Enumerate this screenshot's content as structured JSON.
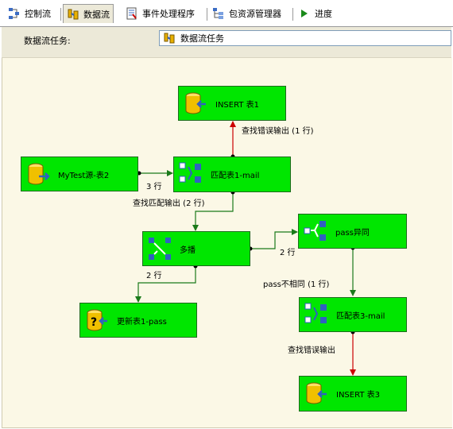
{
  "tabs": [
    {
      "label": "控制流",
      "icon": "control-flow-icon",
      "active": false
    },
    {
      "label": "数据流",
      "icon": "data-flow-icon",
      "active": true
    },
    {
      "label": "事件处理程序",
      "icon": "event-handler-icon",
      "active": false
    },
    {
      "label": "包资源管理器",
      "icon": "package-explorer-icon",
      "active": false
    },
    {
      "label": "进度",
      "icon": "progress-icon",
      "active": false
    }
  ],
  "task": {
    "label": "数据流任务:",
    "selected_value": "数据流任务"
  },
  "nodes": {
    "insert_table1": "INSERT 表1",
    "source": "MyTest源-表2",
    "match_email": "匹配表1-mail",
    "multicast": "多播",
    "pass_diff": "pass异同",
    "update_table1": "更新表1-pass",
    "match_table3": "匹配表3-mail",
    "insert_table3": "INSERT 表3"
  },
  "flow_labels": {
    "error_out1": "查找错误输出 (1 行)",
    "rows3": "3 行",
    "match_out": "查找匹配输出 (2 行)",
    "rows2a": "2 行",
    "rows2b": "2 行",
    "pass_not_same": "pass不相同 (1 行)",
    "error_out2": "查找错误输出"
  },
  "colors": {
    "node_fill": "#00e600",
    "flow_green": "#1a7a1a",
    "flow_red": "#cc0000",
    "canvas_bg": "#fbf8e6",
    "toolbar_bg": "#ece9d8"
  }
}
